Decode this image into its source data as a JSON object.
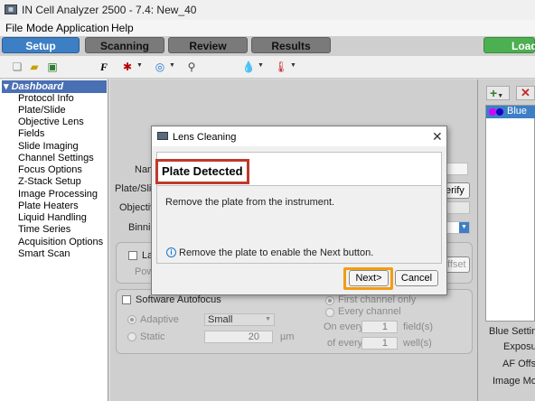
{
  "window": {
    "title": "IN Cell Analyzer 2500 - 7.4: New_40",
    "icon": "app-icon"
  },
  "menu": [
    {
      "label": "File",
      "name": "menu-file"
    },
    {
      "label": "Mode",
      "name": "menu-mode"
    },
    {
      "label": "Application",
      "name": "menu-application"
    },
    {
      "label": "Help",
      "name": "menu-help"
    }
  ],
  "tabs": {
    "setup": "Setup",
    "scanning": "Scanning",
    "review": "Review",
    "results": "Results",
    "load": "Load",
    "active_color": "#3d7fc5",
    "load_color": "#4caf50"
  },
  "toolbar_icons": [
    "new-icon",
    "open-folder-icon",
    "save-icon",
    "font-icon",
    "laser-icon",
    "target-icon",
    "microscope-icon",
    "drop-icon",
    "thermometer-icon"
  ],
  "sidebar": {
    "header": "Dashboard",
    "items": [
      "Protocol Info",
      "Plate/Slide",
      "Objective Lens",
      "Fields",
      "Slide Imaging",
      "Channel Settings",
      "Focus Options",
      "Z-Stack Setup",
      "Image Processing",
      "Plate Heaters",
      "Liquid Handling",
      "Time Series",
      "Acquisition Options",
      "Smart Scan"
    ]
  },
  "center": {
    "name_label": "Nam",
    "plate_label": "Plate/Slid",
    "objective_label": "Objectiv",
    "binning_label": "Binnin",
    "verify_label": "erify",
    "laser_label": "La",
    "power_label": "Pow",
    "offset_label": "ffset",
    "software_autofocus": "Software Autofocus",
    "adaptive": "Adaptive",
    "adaptive_value": "Small",
    "static": "Static",
    "static_value": "20",
    "static_unit": "µm",
    "first_channel_only": "First channel only",
    "every_channel": "Every channel",
    "on_every": "On every",
    "on_every_value": "1",
    "fields_unit": "field(s)",
    "of_every": "of every",
    "of_every_value": "1",
    "wells_unit": "well(s)"
  },
  "right_panel": {
    "channel_name": "Blue",
    "blue_setting": "Blue Setting",
    "exposure": "Exposur",
    "af_offset": "AF Offse",
    "image_mode": "Image Mod"
  },
  "dialog": {
    "title": "Lens Cleaning",
    "heading": "Plate Detected",
    "message": "Remove the plate from the instrument.",
    "info": "Remove the plate to enable the Next button.",
    "next": "Next>",
    "cancel": "Cancel",
    "highlight_color": "#c0392b",
    "next_highlight_color": "#f39c12"
  }
}
